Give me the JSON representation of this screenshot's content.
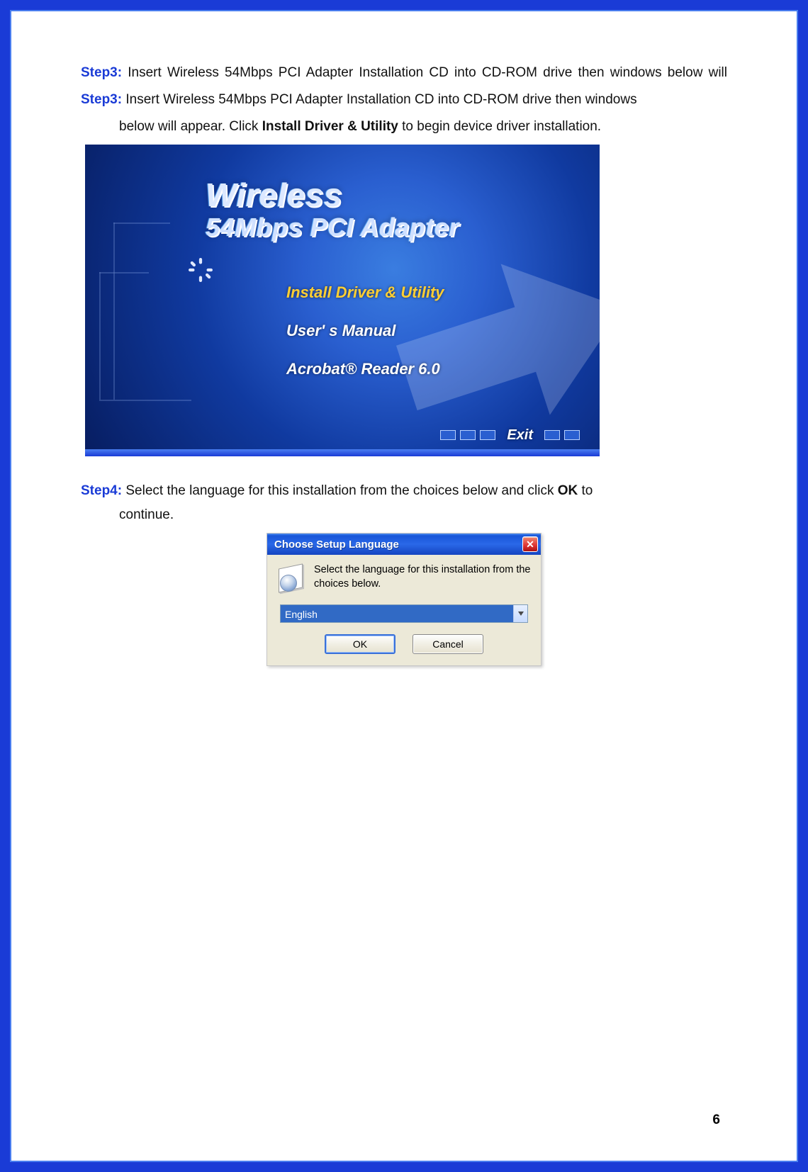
{
  "page_number": "6",
  "step3": {
    "label": "Step3:",
    "text_before": " Insert Wireless 54Mbps PCI Adapter Installation CD into CD-ROM drive then windows below will appear. Click ",
    "bold_part": "Install Driver & Utility",
    "text_after": " to begin device driver installation."
  },
  "autorun": {
    "title": "Wireless",
    "subtitle": "54Mbps PCI Adapter",
    "menu_install": "Install Driver & Utility",
    "menu_manual": "User' s Manual",
    "menu_acrobat": "Acrobat® Reader 6.0",
    "exit": "Exit"
  },
  "step4": {
    "label": "Step4:",
    "text_before": " Select the language for this installation from the choices below and click ",
    "bold_part": "OK",
    "text_after": " to continue."
  },
  "dialog": {
    "title": "Choose Setup Language",
    "message": "Select the language for this installation from the choices below.",
    "selected": "English",
    "ok": "OK",
    "cancel": "Cancel"
  }
}
